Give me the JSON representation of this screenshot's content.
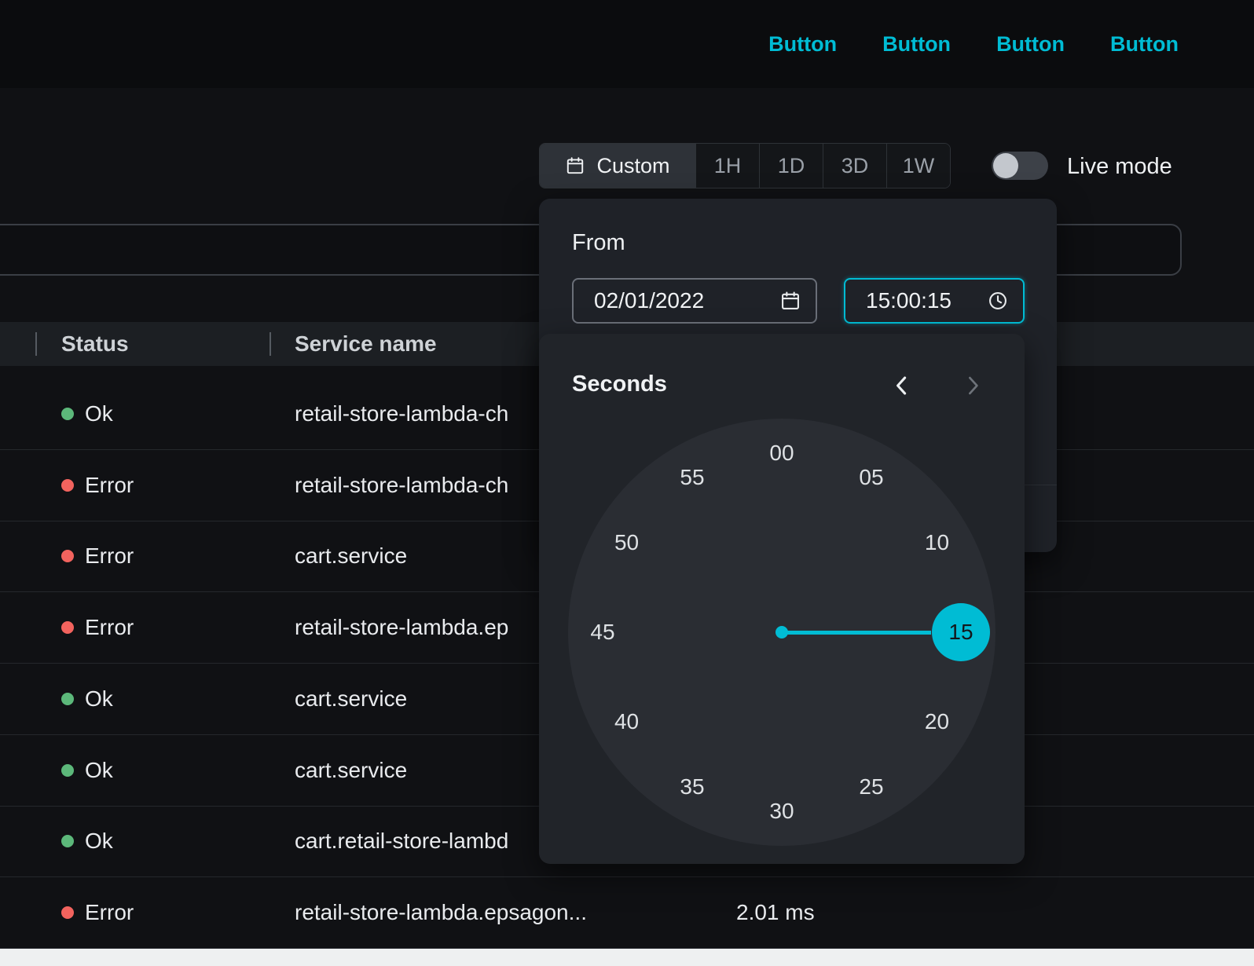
{
  "colors": {
    "accent": "#00bcd4",
    "ok_dot": "#5cb87a",
    "error_dot": "#f2635e"
  },
  "topbar": {
    "buttons": [
      "Button",
      "Button",
      "Button",
      "Button"
    ]
  },
  "toolbar": {
    "custom_label": "Custom",
    "ranges": [
      "1H",
      "1D",
      "3D",
      "1W"
    ],
    "live_mode_label": "Live mode",
    "live_mode_on": false
  },
  "search": {
    "value": ""
  },
  "date_panel": {
    "from_label": "From",
    "date_value": "02/01/2022",
    "time_value": "15:00:15"
  },
  "time_picker": {
    "title": "Seconds",
    "values": [
      "00",
      "05",
      "10",
      "15",
      "20",
      "25",
      "30",
      "35",
      "40",
      "45",
      "50",
      "55"
    ],
    "selected": "15"
  },
  "table": {
    "columns": [
      "Status",
      "Service name"
    ],
    "rows": [
      {
        "status": "Ok",
        "service": "retail-store-lambda-ch",
        "duration": ""
      },
      {
        "status": "Error",
        "service": "retail-store-lambda-ch",
        "duration": ""
      },
      {
        "status": "Error",
        "service": "cart.service",
        "duration": ""
      },
      {
        "status": "Error",
        "service": "retail-store-lambda.ep",
        "duration": ""
      },
      {
        "status": "Ok",
        "service": "cart.service",
        "duration": ""
      },
      {
        "status": "Ok",
        "service": "cart.service",
        "duration": ""
      },
      {
        "status": "Ok",
        "service": "cart.retail-store-lambd",
        "duration": ""
      },
      {
        "status": "Error",
        "service": "retail-store-lambda.epsagon...",
        "duration": "2.01 ms"
      }
    ]
  }
}
